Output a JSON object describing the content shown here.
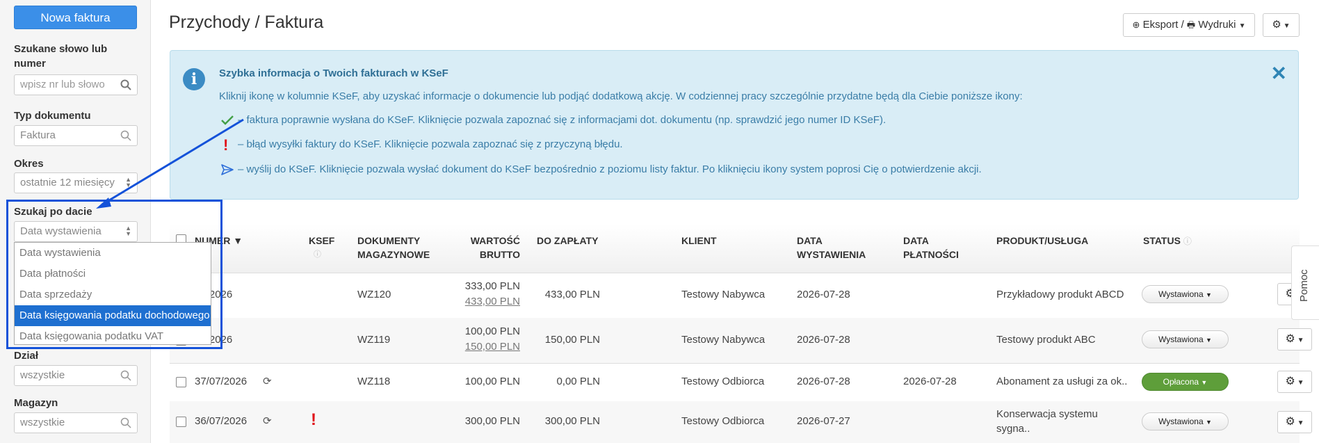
{
  "sidebar": {
    "new_invoice": "Nowa faktura",
    "search_label": "Szukane słowo lub numer",
    "search_placeholder": "wpisz nr lub słowo",
    "doc_type_label": "Typ dokumentu",
    "doc_type_value": "Faktura",
    "period_label": "Okres",
    "period_value": "ostatnie 12 miesięcy",
    "date_search_label": "Szukaj po dacie",
    "date_search_value": "Data wystawienia",
    "date_options": [
      "Data wystawienia",
      "Data płatności",
      "Data sprzedaży",
      "Data księgowania podatku dochodowego",
      "Data księgowania podatku VAT"
    ],
    "date_selected_index": 3,
    "department_label": "Dział",
    "department_value": "wszystkie",
    "warehouse_label": "Magazyn",
    "warehouse_value": "wszystkie"
  },
  "header": {
    "title": "Przychody / Faktura",
    "export_label": "Eksport / ",
    "print_label": "Wydruki"
  },
  "info": {
    "heading": "Szybka informacja o Twoich fakturach w KSeF",
    "intro": "Kliknij ikonę w kolumnie KSeF, aby uzyskać informacje o dokumencie lub podjąć dodatkową akcję. W codziennej pracy szczególnie przydatne będą dla Ciebie poniższe ikony:",
    "ok_text": "– faktura poprawnie wysłana do KSeF. Kliknięcie pozwala zapoznać się z informacjami dot. dokumentu (np. sprawdzić jego numer ID KSeF).",
    "error_text": "– błąd wysyłki faktury do KSeF. Kliknięcie pozwala zapoznać się z przyczyną błędu.",
    "send_text": "– wyślij do KSeF. Kliknięcie pozwala wysłać dokument do KSeF bezpośrednio z poziomu listy faktur. Po kliknięciu ikony system poprosi Cię o potwierdzenie akcji.",
    "close": "✕"
  },
  "table": {
    "headers": {
      "number": "NUMER ▼",
      "ksef": "KSEF",
      "docs_1": "DOKUMENTY",
      "docs_2": "MAGAZYNOWE",
      "gross_1": "WARTOŚĆ",
      "gross_2": "BRUTTO",
      "to_pay": "DO ZAPŁATY",
      "client": "KLIENT",
      "issue_1": "DATA",
      "issue_2": "WYSTAWIENIA",
      "payment_1": "DATA",
      "payment_2": "PŁATNOŚCI",
      "product": "PRODUKT/USŁUGA",
      "status": "STATUS"
    },
    "rows": [
      {
        "number": "07/2026",
        "wz": "WZ120",
        "gross": "333,00 PLN",
        "gross_old": "433,00 PLN",
        "to_pay": "433,00 PLN",
        "client": "Testowy Nabywca",
        "issue": "2026-07-28",
        "payment": "",
        "product": "Przykładowy produkt ABCD",
        "status": "Wystawiona"
      },
      {
        "number": "07/2026",
        "wz": "WZ119",
        "gross": "100,00 PLN",
        "gross_old": "150,00 PLN",
        "to_pay": "150,00 PLN",
        "client": "Testowy Nabywca",
        "issue": "2026-07-28",
        "payment": "",
        "product": "Testowy produkt ABC",
        "status": "Wystawiona"
      },
      {
        "number": "37/07/2026",
        "wz": "WZ118",
        "gross": "100,00 PLN",
        "gross_old": "",
        "to_pay": "0,00 PLN",
        "client": "Testowy Odbiorca",
        "issue": "2026-07-28",
        "payment": "2026-07-28",
        "product": "Abonament za usługi za ok..",
        "status": "Opłacona"
      },
      {
        "number": "36/07/2026",
        "wz": "",
        "gross": "300,00 PLN",
        "gross_old": "",
        "to_pay": "300,00 PLN",
        "client": "Testowy Odbiorca",
        "issue": "2026-07-27",
        "payment": "",
        "product": "Konserwacja systemu",
        "product_2": "sygna..",
        "status": "Wystawiona"
      }
    ]
  },
  "help_tab": "Pomoc",
  "colors": {
    "primary": "#3b8fe8",
    "highlight": "#1452d9",
    "info_bg": "#d9edf6",
    "paid": "#5e9e3a",
    "error": "#e0131a"
  }
}
